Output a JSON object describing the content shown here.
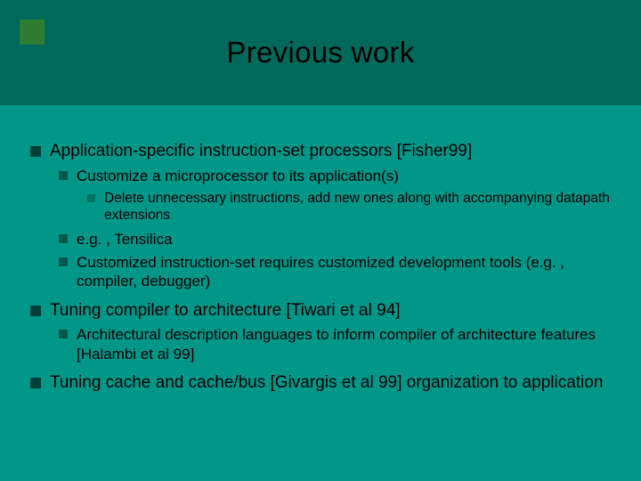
{
  "title": "Previous work",
  "bullets": {
    "b1_1": "Application-specific instruction-set processors [Fisher99]",
    "b1_1_b2_1": "Customize a microprocessor to its application(s)",
    "b1_1_b2_1_b3_1": "Delete unnecessary instructions, add new ones along with accompanying datapath extensions",
    "b1_1_b2_2": "e.g. , Tensilica",
    "b1_1_b2_3": "Customized instruction-set requires customized development tools (e.g. , compiler, debugger)",
    "b1_2": "Tuning compiler to architecture [Tiwari et al 94]",
    "b1_2_b2_1": "Architectural description languages to inform compiler of architecture features [Halambi et al 99]",
    "b1_3": "Tuning cache and cache/bus [Givargis et al 99] organization to application"
  }
}
